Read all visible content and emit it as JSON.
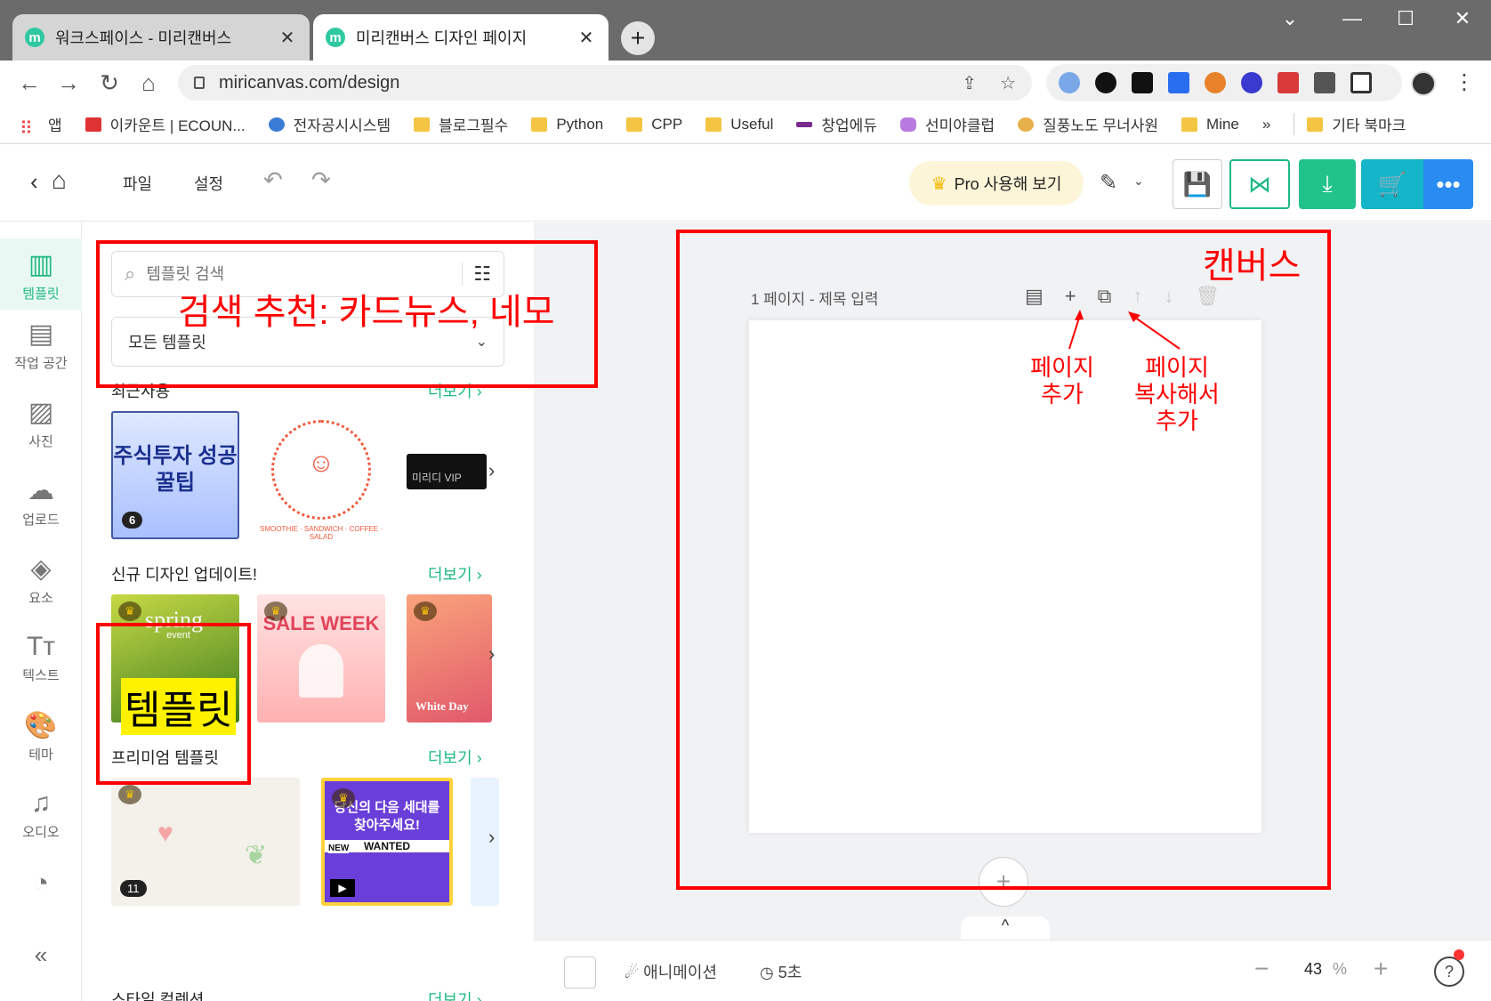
{
  "browser": {
    "tabs": [
      {
        "title": "워크스페이스 - 미리캔버스",
        "favicon": "m"
      },
      {
        "title": "미리캔버스 디자인 페이지",
        "favicon": "m"
      }
    ],
    "new_tab": "+",
    "url": "miricanvas.com/design",
    "bookmarks": [
      "앱",
      "이카운트 | ECOUN...",
      "전자공시시스템",
      "블로그필수",
      "Python",
      "CPP",
      "Useful",
      "창업에듀",
      "선미야클럽",
      "질풍노도 무너사원",
      "Mine"
    ],
    "bookmarks_more": "»",
    "other_bookmarks": "기타 북마크"
  },
  "app": {
    "menu": {
      "file": "파일",
      "settings": "설정"
    },
    "pro_button": "Pro 사용해 보기",
    "rail": [
      {
        "label": "템플릿",
        "icon": "template-icon"
      },
      {
        "label": "작업 공간",
        "icon": "archive-icon"
      },
      {
        "label": "사진",
        "icon": "image-icon"
      },
      {
        "label": "업로드",
        "icon": "upload-icon"
      },
      {
        "label": "요소",
        "icon": "elements-icon"
      },
      {
        "label": "텍스트",
        "icon": "text-icon"
      },
      {
        "label": "테마",
        "icon": "palette-icon"
      },
      {
        "label": "오디오",
        "icon": "music-icon"
      }
    ],
    "panel": {
      "search_placeholder": "템플릿 검색",
      "select_value": "모든 템플릿",
      "sections": [
        {
          "title": "최근사용",
          "more": "더보기"
        },
        {
          "title": "신규 디자인 업데이트!",
          "more": "더보기"
        },
        {
          "title": "프리미엄 템플릿",
          "more": "더보기"
        },
        {
          "title": "스타일 컬렉션",
          "more": "더보기"
        }
      ],
      "recent": {
        "stock_tip": "주식투자 성공꿀팁",
        "stock_badge": "6",
        "sandwich": "SMOOTHIE · SANDWICH · COFFEE · SALAD",
        "vip": "미리디 VIP"
      },
      "new": {
        "spring": "spring",
        "spring_sub": "event",
        "sale": "SALE WEEK",
        "white": "White Day"
      },
      "premium": {
        "pastel_badge": "11",
        "wanted_title": "당신의 다음 세대를 찾아주세요!",
        "wanted_tag": "WANTED",
        "wanted_new": "NEW"
      }
    },
    "canvas": {
      "page_label": "1 페이지 - 제목 입력",
      "collapse": "^"
    },
    "bottom": {
      "animation": "애니메이션",
      "duration": "5초",
      "zoom": "43",
      "zoom_unit": "%"
    }
  },
  "annotations": {
    "search_tip": "검색 추천: 카드뉴스, 네모",
    "template": "템플릿",
    "canvas": "캔버스",
    "add_page": [
      "페이지",
      "추가"
    ],
    "copy_page": [
      "페이지",
      "복사해서",
      "추가"
    ],
    "color": "#ff0000"
  }
}
